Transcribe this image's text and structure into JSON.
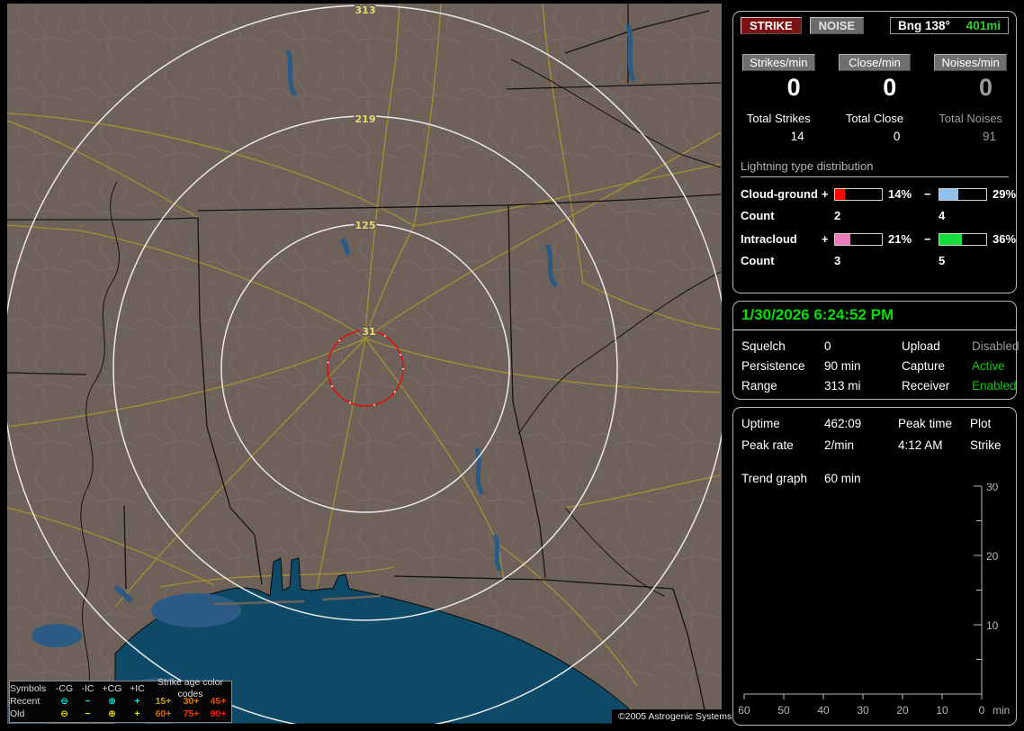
{
  "header": {
    "strike": "STRIKE",
    "noise": "NOISE",
    "bearing": "Bng 138°",
    "range": "401mi"
  },
  "counters": {
    "cols": [
      {
        "label": "Strikes/min",
        "rate": "0",
        "total_label": "Total Strikes",
        "total": "14"
      },
      {
        "label": "Close/min",
        "rate": "0",
        "total_label": "Total Close",
        "total": "0"
      },
      {
        "label": "Noises/min",
        "rate": "0",
        "total_label": "Total Noises",
        "total": "91"
      }
    ]
  },
  "distribution": {
    "title": "Lightning type distribution",
    "count_label": "Count",
    "plus": "+",
    "minus": "−",
    "rows": [
      {
        "name": "Cloud-ground",
        "plus_pct": "14%",
        "plus_fill": "22%",
        "plus_color": "#ff0000",
        "minus_pct": "29%",
        "minus_fill": "40%",
        "minus_color": "#8fc1ea",
        "plus_count": "2",
        "minus_count": "4"
      },
      {
        "name": "Intracloud",
        "plus_pct": "21%",
        "plus_fill": "32%",
        "plus_color": "#e87bb8",
        "minus_pct": "36%",
        "minus_fill": "48%",
        "minus_color": "#16dd3c",
        "plus_count": "3",
        "minus_count": "5"
      }
    ]
  },
  "status": {
    "datetime": "1/30/2026 6:24:52 PM",
    "rows": [
      [
        "Squelch",
        "0",
        "Upload",
        "Disabled"
      ],
      [
        "Persistence",
        "90 min",
        "Capture",
        "Active"
      ],
      [
        "Range",
        "313 mi",
        "Receiver",
        "Enabled"
      ]
    ]
  },
  "stats": {
    "r1": [
      "Uptime",
      "462:09",
      "Peak time",
      "Plot"
    ],
    "r2": [
      "Peak rate",
      "2/min",
      "4:12 AM",
      "Strike"
    ],
    "r3": [
      "Trend graph",
      "60 min"
    ]
  },
  "chart_data": {
    "type": "line",
    "title": "Trend graph 60 min",
    "series": [],
    "x_ticks": [
      "60",
      "50",
      "40",
      "30",
      "20",
      "10",
      "0"
    ],
    "y_ticks": [
      "30",
      "20",
      "10"
    ],
    "x_unit": "min",
    "ylim": [
      0,
      30
    ],
    "xlim_minutes_ago": [
      60,
      0
    ],
    "note": "empty trend plot - no strikes in window"
  },
  "trend": {
    "y_ticks": [
      "30",
      "20",
      "10"
    ],
    "x_ticks": [
      "60",
      "50",
      "40",
      "30",
      "20",
      "10",
      "0"
    ],
    "unit": "min"
  },
  "map": {
    "rings": [
      "313",
      "219",
      "125",
      "31"
    ],
    "copyright": "©2005 Astrogenic Systems"
  },
  "legend": {
    "headers": [
      "Symbols",
      "-CG",
      "-IC",
      "+CG",
      "+IC"
    ],
    "age_title": "Strike age color codes",
    "recent": {
      "label": "Recent",
      "color": "#00e0e0",
      "sym": [
        "⊖",
        "−",
        "⊕",
        "+"
      ],
      "ages": [
        {
          "t": "15+",
          "c": "#d2a800"
        },
        {
          "t": "30+",
          "c": "#e07d00"
        },
        {
          "t": "45+",
          "c": "#e05200"
        }
      ]
    },
    "old": {
      "label": "Old",
      "color": "#e0e000",
      "sym": [
        "⊖",
        "−",
        "⊕",
        "+"
      ],
      "ages": [
        {
          "t": "60+",
          "c": "#e06a00"
        },
        {
          "t": "75+",
          "c": "#ee3800"
        },
        {
          "t": "90+",
          "c": "#ff1200"
        }
      ]
    }
  },
  "colors": {
    "strike_red": "#7c1212",
    "range_green": "#2ecc2e",
    "date_green": "#00dd00",
    "green": "#00cc00",
    "dim": "#9a9a9a",
    "ring_label": "#e8d870",
    "red_ring": "#dd1111"
  }
}
